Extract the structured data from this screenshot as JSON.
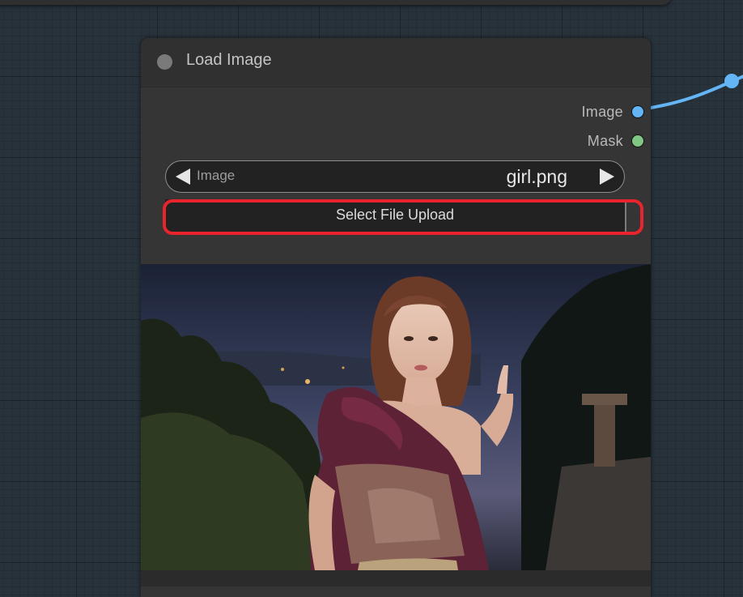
{
  "node": {
    "title": "Load Image",
    "outputs": [
      {
        "label": "Image",
        "color": "#64b5f6"
      },
      {
        "label": "Mask",
        "color": "#81c784"
      }
    ],
    "image_widget": {
      "label": "Image",
      "value": "girl.png"
    },
    "upload_button": {
      "label": "Select File Upload"
    },
    "preview": {
      "content": "photo of a woman in a ruffled burgundy dress pointing upward, night landscape background"
    }
  },
  "colors": {
    "canvas": "#28323b",
    "node_body": "#353535",
    "link": "#64b5f6",
    "highlight": "#e8242c"
  }
}
